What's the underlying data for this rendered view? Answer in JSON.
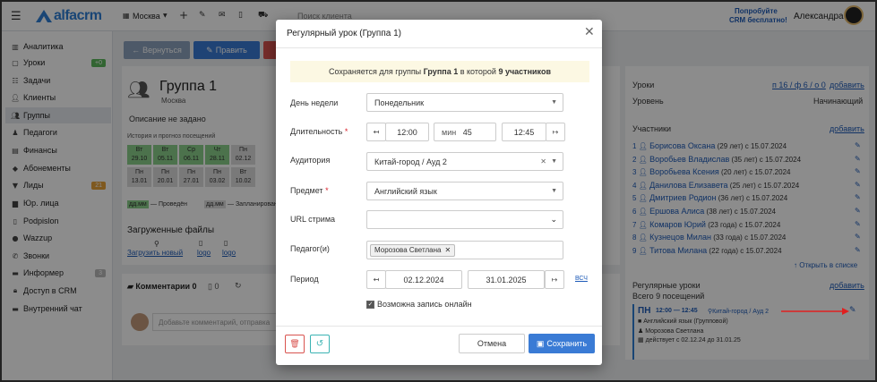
{
  "topbar": {
    "brand": "alfacrm",
    "branch": "Москва",
    "search_placeholder": "Поиск клиента",
    "promo_line1": "Попробуйте",
    "promo_line2": "CRM бесплатно!",
    "user_name": "Александра"
  },
  "sidebar": {
    "items": [
      {
        "label": "Аналитика",
        "icon": "chart-icon"
      },
      {
        "label": "Уроки",
        "icon": "calendar-icon",
        "badge": "+0"
      },
      {
        "label": "Задачи",
        "icon": "tasks-icon"
      },
      {
        "label": "Клиенты",
        "icon": "user-icon"
      },
      {
        "label": "Группы",
        "icon": "users-icon"
      },
      {
        "label": "Педагоги",
        "icon": "teacher-icon"
      },
      {
        "label": "Финансы",
        "icon": "money-icon"
      },
      {
        "label": "Абонементы",
        "icon": "tag-icon"
      },
      {
        "label": "Лиды",
        "icon": "funnel-icon",
        "badge": "21"
      },
      {
        "label": "Юр. лица",
        "icon": "building-icon"
      },
      {
        "label": "Podpislon",
        "icon": "doc-icon"
      },
      {
        "label": "Wazzup",
        "icon": "chat-icon"
      },
      {
        "label": "Звонки",
        "icon": "phone-icon"
      },
      {
        "label": "Информер",
        "icon": "inbox-icon",
        "badge": "3"
      },
      {
        "label": "Доступ в CRM",
        "icon": "lock-icon"
      },
      {
        "label": "Внутренний чат",
        "icon": "message-icon"
      }
    ]
  },
  "main": {
    "back_label": "Вернуться",
    "edit_label": "Править",
    "group_title": "Группа 1",
    "group_city": "Москва",
    "description": "Описание не задано",
    "history_label": "История и прогноз посещений",
    "days_row1": [
      {
        "d": "Вт",
        "n": "29.10"
      },
      {
        "d": "Вт",
        "n": "05.11"
      },
      {
        "d": "Ср",
        "n": "06.11"
      },
      {
        "d": "Чт",
        "n": "28.11"
      },
      {
        "d": "Пн",
        "n": "02.12"
      }
    ],
    "days_row2": [
      {
        "d": "Пн",
        "n": "13.01"
      },
      {
        "d": "Пн",
        "n": "20.01"
      },
      {
        "d": "Пн",
        "n": "27.01"
      },
      {
        "d": "Пн",
        "n": "03.02"
      },
      {
        "d": "Вт",
        "n": "10.02"
      }
    ],
    "legend_done": "— Проведён",
    "legend_planned": "— Запланирован",
    "legend_dm": "дд.мм",
    "files_title": "Загруженные файлы",
    "upload_label": "Загрузить новый",
    "file1": "logo",
    "file2": "logo",
    "comments_tab": "Комментарии 0",
    "tab2_count": "0",
    "comment_placeholder": "Добавьте комментарий, отправка"
  },
  "right": {
    "lessons_label": "Уроки",
    "lessons_value": "п 16 / ф 6 / о 0",
    "add_label": "добавить",
    "level_label": "Уровень",
    "level_value": "Начинающий",
    "participants_title": "Участники",
    "participants": [
      {
        "n": "1",
        "name": "Борисова Оксана",
        "age": "(29 лет)",
        "since": "с 15.07.2024"
      },
      {
        "n": "2",
        "name": "Воробьев Владислав",
        "age": "(35 лет)",
        "since": "с 15.07.2024"
      },
      {
        "n": "3",
        "name": "Воробьева Ксения",
        "age": "(20 лет)",
        "since": "с 15.07.2024"
      },
      {
        "n": "4",
        "name": "Данилова Елизавета",
        "age": "(25 лет)",
        "since": "с 15.07.2024"
      },
      {
        "n": "5",
        "name": "Дмитриев Родион",
        "age": "(36 лет)",
        "since": "с 15.07.2024"
      },
      {
        "n": "6",
        "name": "Ершова Алиса",
        "age": "(38 лет)",
        "since": "с 15.07.2024"
      },
      {
        "n": "7",
        "name": "Комаров Юрий",
        "age": "(23 года)",
        "since": "с 15.07.2024"
      },
      {
        "n": "8",
        "name": "Кузнецов Милан",
        "age": "(33 года)",
        "since": "с 15.07.2024"
      },
      {
        "n": "9",
        "name": "Титова Милана",
        "age": "(22 года)",
        "since": "с 15.07.2024"
      }
    ],
    "open_all": "Открыть в списке",
    "regular_title": "Регулярные уроки",
    "visits_total": "Всего 9 посещений",
    "reg_day": "ПН",
    "reg_time": "12:00 — 12:45",
    "reg_room": "Китай-город / Ауд 2",
    "reg_subject": "Английский язык (Групповой)",
    "reg_teacher": "Морозова Светлана",
    "reg_period": "действует с 02.12.24 до 31.01.25"
  },
  "modal": {
    "title": "Регулярный урок (Группа 1)",
    "note_pre": "Сохраняется для группы",
    "note_group": "Группа 1",
    "note_mid": "в которой",
    "note_count": "9 участников",
    "day_label": "День недели",
    "day_value": "Понедельник",
    "duration_label": "Длительность",
    "time_start": "12:00",
    "min_label": "мин",
    "minutes": "45",
    "time_end": "12:45",
    "room_label": "Аудитория",
    "room_value": "Китай-город / Ауд 2",
    "subject_label": "Предмет",
    "subject_value": "Английский язык",
    "stream_label": "URL стрима",
    "teacher_label": "Педагог(и)",
    "teacher_chip": "Морозова Светлана",
    "period_label": "Период",
    "date_start": "02.12.2024",
    "date_end": "31.01.2025",
    "period_link": "ВСЧ",
    "online_label": "Возможна запись онлайн",
    "cancel_label": "Отмена",
    "save_label": "Сохранить",
    "required_mark": "*"
  }
}
